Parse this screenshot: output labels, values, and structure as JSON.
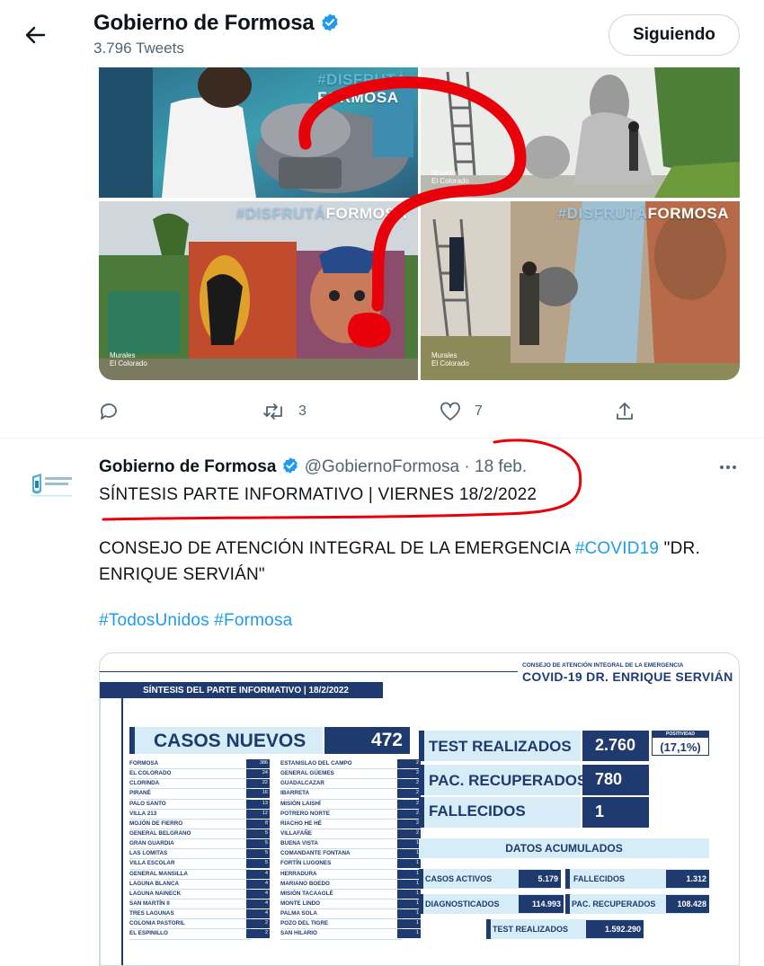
{
  "header": {
    "back_label": "Back",
    "account_name": "Gobierno de Formosa",
    "tweet_count": "3.796 Tweets",
    "follow_button": "Siguiendo"
  },
  "media": {
    "tag_disfruta": "#DISFRUTÁ",
    "tag_formosa": "FORMOSA",
    "caption_line1": "Murales",
    "caption_line2": "El Colorado"
  },
  "actions": {
    "reply_count": "",
    "retweet_count": "3",
    "like_count": "7"
  },
  "tweet2": {
    "name": "Gobierno de Formosa",
    "handle": "@GobiernoFormosa",
    "separator": "·",
    "date": "18 feb.",
    "headline": "SÍNTESIS PARTE INFORMATIVO | VIERNES 18/2/2022",
    "body_text": "CONSEJO DE ATENCIÓN INTEGRAL DE LA EMERGENCIA ",
    "body_hashtag": "#COVID19",
    "body_tail": " \"DR. ENRIQUE SERVIÁN\"",
    "hashtags": "#TodosUnidos #Formosa"
  },
  "card": {
    "council": "CONSEJO DE ATENCIÓN INTEGRAL DE LA EMERGENCIA",
    "covid_title": "COVID-19 DR. ENRIQUE SERVIÁN",
    "synthesis": "SÍNTESIS DEL PARTE INFORMATIVO | 18/2/2022",
    "casos_label": "CASOS NUEVOS",
    "casos_value": "472",
    "left_localities": [
      {
        "name": "FORMOSA",
        "value": "386"
      },
      {
        "name": "EL COLORADO",
        "value": "24"
      },
      {
        "name": "CLORINDA",
        "value": "22"
      },
      {
        "name": "PIRANÉ",
        "value": "16"
      },
      {
        "name": "PALO SANTO",
        "value": "13"
      },
      {
        "name": "VILLA 213",
        "value": "12"
      },
      {
        "name": "MOJÓN DE FIERRO",
        "value": "8"
      },
      {
        "name": "GENERAL BELGRANO",
        "value": "5"
      },
      {
        "name": "GRAN GUARDIA",
        "value": "5"
      },
      {
        "name": "LAS LOMITAS",
        "value": "5"
      },
      {
        "name": "VILLA ESCOLAR",
        "value": "5"
      },
      {
        "name": "GENERAL MANSILLA",
        "value": "4"
      },
      {
        "name": "LAGUNA BLANCA",
        "value": "4"
      },
      {
        "name": "LAGUNA NAINECK",
        "value": "4"
      },
      {
        "name": "SAN MARTÍN II",
        "value": "4"
      },
      {
        "name": "TRES LAGUNAS",
        "value": "4"
      },
      {
        "name": "COLONIA PASTORIL",
        "value": "2"
      },
      {
        "name": "EL ESPINILLO",
        "value": "2"
      }
    ],
    "right_localities": [
      {
        "name": "ESTANISLAO DEL CAMPO",
        "value": "2"
      },
      {
        "name": "GENERAL GÜEMES",
        "value": "2"
      },
      {
        "name": "GUADALCAZAR",
        "value": "2"
      },
      {
        "name": "IBARRETA",
        "value": "2"
      },
      {
        "name": "MISIÓN LAISHÍ",
        "value": "2"
      },
      {
        "name": "POTRERO NORTE",
        "value": "2"
      },
      {
        "name": "RIACHO HE HÉ",
        "value": "2"
      },
      {
        "name": "VILLAFAÑE",
        "value": "2"
      },
      {
        "name": "BUENA VISTA",
        "value": "1"
      },
      {
        "name": "COMANDANTE FONTANA",
        "value": "1"
      },
      {
        "name": "FORTÍN LUGONES",
        "value": "1"
      },
      {
        "name": "HERRADURA",
        "value": "1"
      },
      {
        "name": "MARIANO BOEDO",
        "value": "1"
      },
      {
        "name": "MISIÓN TACAAGLÉ",
        "value": "1"
      },
      {
        "name": "MONTE LINDO",
        "value": "1"
      },
      {
        "name": "PALMA SOLA",
        "value": "1"
      },
      {
        "name": "POZO DEL TIGRE",
        "value": "1"
      },
      {
        "name": "SAN HILARIO",
        "value": "1"
      }
    ],
    "test_label": "TEST REALIZADOS",
    "test_value": "2.760",
    "positividad_label": "POSITIVIDAD",
    "positividad_value": "(17,1%)",
    "recuperados_label": "PAC. RECUPERADOS",
    "recuperados_value": "780",
    "fallecidos_label": "FALLECIDOS",
    "fallecidos_value": "1",
    "acumulados_title": "DATOS ACUMULADOS",
    "acc_activos_label": "CASOS ACTIVOS",
    "acc_activos_value": "5.179",
    "acc_fallecidos_label": "FALLECIDOS",
    "acc_fallecidos_value": "1.312",
    "acc_diagnosticados_label": "DIAGNOSTICADOS",
    "acc_diagnosticados_value": "114.993",
    "acc_recuperados_label": "PAC. RECUPERADOS",
    "acc_recuperados_value": "108.428",
    "acc_test_label": "TEST REALIZADOS",
    "acc_test_value": "1.592.290"
  },
  "colors": {
    "twitter_blue": "#1d9bf0",
    "navy": "#1e3a6e",
    "light_blue": "#d6ecf7",
    "annotation_red": "#e8000b"
  }
}
